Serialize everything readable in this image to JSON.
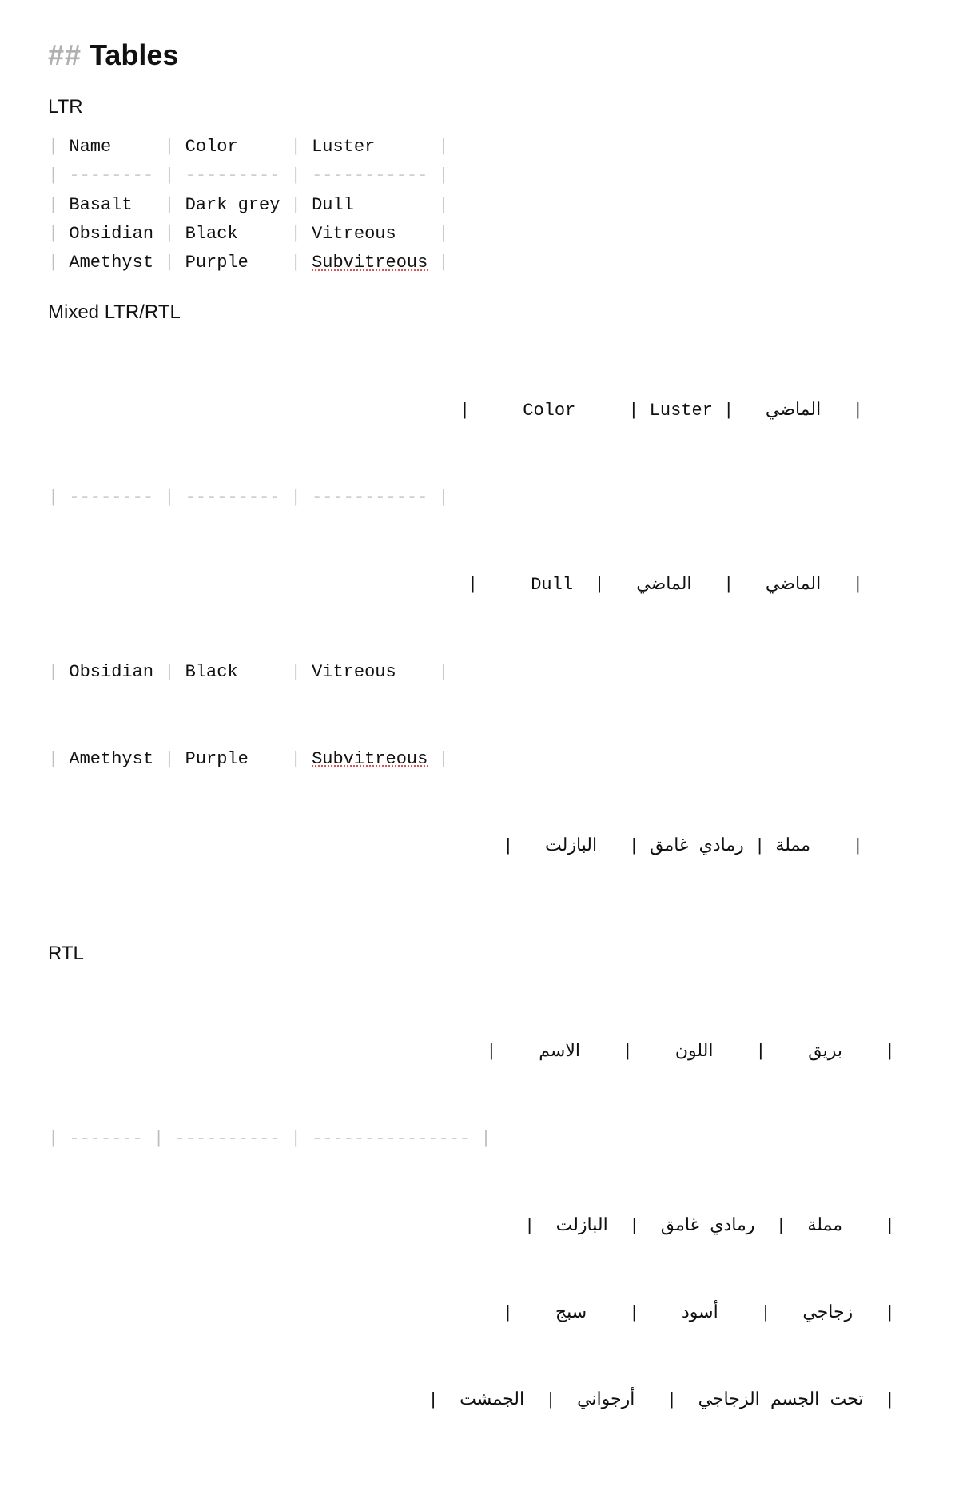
{
  "heading_hash": "##",
  "heading_text": "Tables",
  "sections": {
    "ltr": {
      "title": "LTR",
      "headers": [
        "Name",
        "Color",
        "Luster"
      ],
      "dash_row": [
        "--------",
        "---------",
        "-----------"
      ],
      "rows": [
        [
          "Basalt",
          "Dark grey",
          "Dull"
        ],
        [
          "Obsidian",
          "Black",
          "Vitreous"
        ],
        [
          "Amethyst",
          "Purple",
          "Subvitreous"
        ]
      ],
      "spellcheck_word": "Subvitreous"
    },
    "mixed": {
      "title": "Mixed LTR/RTL",
      "line1_right": "|     Color     | Luster |   الماضي   |",
      "dash_left": "| -------- | --------- | ----------- |",
      "line3_right": "|     Dull  |   الماضي   |   الماضي   |",
      "row_obsidian": [
        "Obsidian",
        "Black",
        "Vitreous"
      ],
      "row_amethyst": [
        "Amethyst",
        "Purple",
        "Subvitreous"
      ],
      "line6_right": "|    مملة | رمادي غامق |   البازلت   |"
    },
    "rtl": {
      "title": "RTL",
      "header_line": "|    بريق    |    اللون    |    الاسم    |",
      "dash_left": "| ------- | ---------- | --------------- |",
      "rows": [
        "|    مملة  |  رمادي غامق  |  البازلت  |",
        "|   زجاجي   |    أسود    |    سبج    |",
        "|  تحت الجسم الزجاجي  |   أرجواني  |  الجمشت  |"
      ]
    }
  }
}
